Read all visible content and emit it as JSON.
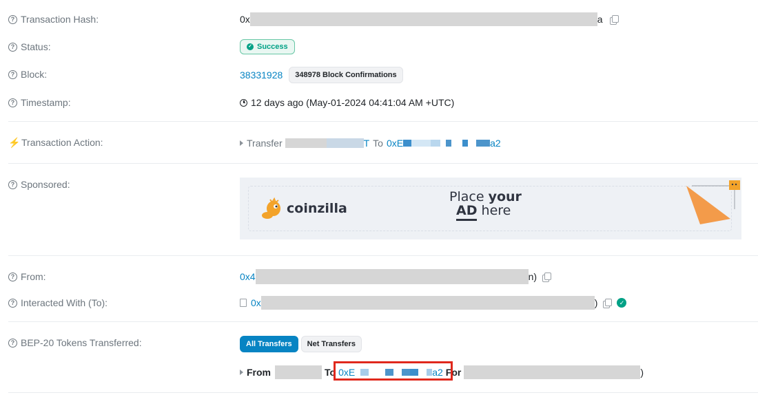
{
  "labels": {
    "tx_hash": "Transaction Hash:",
    "status": "Status:",
    "block": "Block:",
    "timestamp": "Timestamp:",
    "tx_action": "Transaction Action:",
    "sponsored": "Sponsored:",
    "from": "From:",
    "interacted": "Interacted With (To):",
    "bep20": "BEP-20 Tokens Transferred:"
  },
  "tx_hash": {
    "prefix": "0x",
    "suffix": "a"
  },
  "status": {
    "label": "Success"
  },
  "block": {
    "number": "38331928",
    "confirmations": "348978 Block Confirmations"
  },
  "timestamp": {
    "text": "12 days ago (May-01-2024 04:41:04 AM +UTC)"
  },
  "action": {
    "verb": "Transfer",
    "token_end": "T",
    "to_word": "To",
    "to_prefix": "0xE",
    "to_suffix": "a2"
  },
  "ad": {
    "brand": "coinzilla",
    "line1_a": "Place ",
    "line1_b": "your",
    "line2_a": "AD",
    "line2_b": " here"
  },
  "from": {
    "prefix": "0x4",
    "suffix": "n)"
  },
  "interacted": {
    "prefix": "0x",
    "suffix": ")"
  },
  "bep20": {
    "tabs": [
      "All Transfers",
      "Net Transfers"
    ],
    "from_word": "From",
    "to_word": "To",
    "to_prefix": "0xE",
    "to_suffix": "a2",
    "for_word": "For",
    "end": ")"
  },
  "colors": {
    "link": "#0784c3",
    "success": "#00a186",
    "highlight": "#e0281c"
  }
}
